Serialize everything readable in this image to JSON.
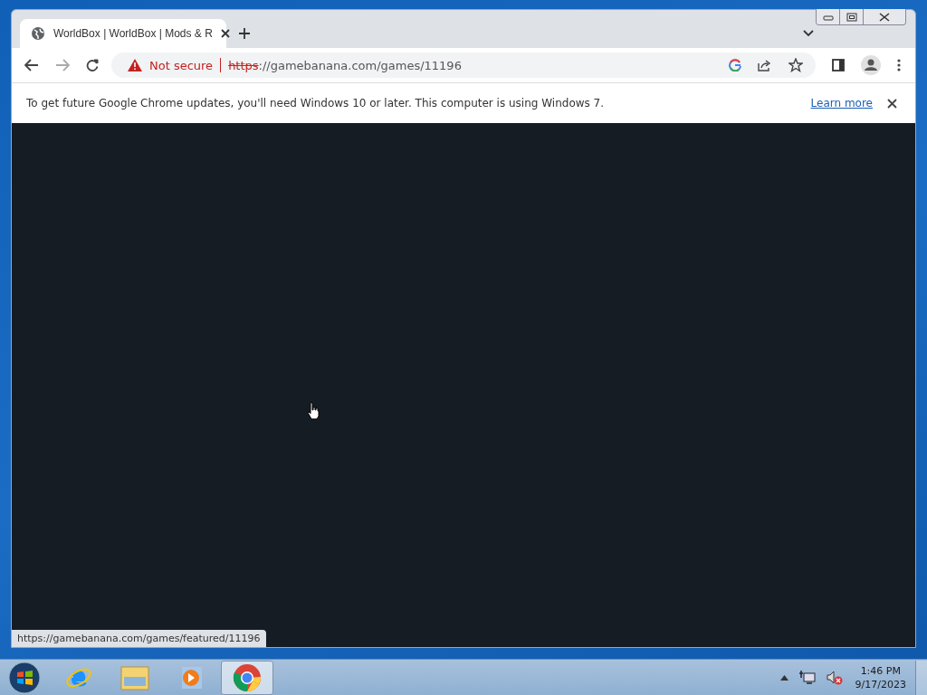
{
  "browser": {
    "tabs": [
      {
        "title": "WorldBox | WorldBox | Mods & R",
        "selected": true
      }
    ],
    "address_bar": {
      "security_label": "Not secure",
      "scheme": "https",
      "rest": "://gamebanana.com/games/11196"
    },
    "infobar": {
      "message": "To get future Google Chrome updates, you'll need Windows 10 or later. This computer is using Windows 7.",
      "link": "Learn more"
    },
    "status_url": "https://gamebanana.com/games/featured/11196"
  },
  "taskbar": {
    "items": [
      {
        "kind": "ie",
        "selected": false
      },
      {
        "kind": "folder",
        "selected": false
      },
      {
        "kind": "media",
        "selected": false
      },
      {
        "kind": "chrome",
        "selected": true
      }
    ],
    "clock": {
      "time": "1:46 PM",
      "date": "9/17/2023"
    }
  }
}
